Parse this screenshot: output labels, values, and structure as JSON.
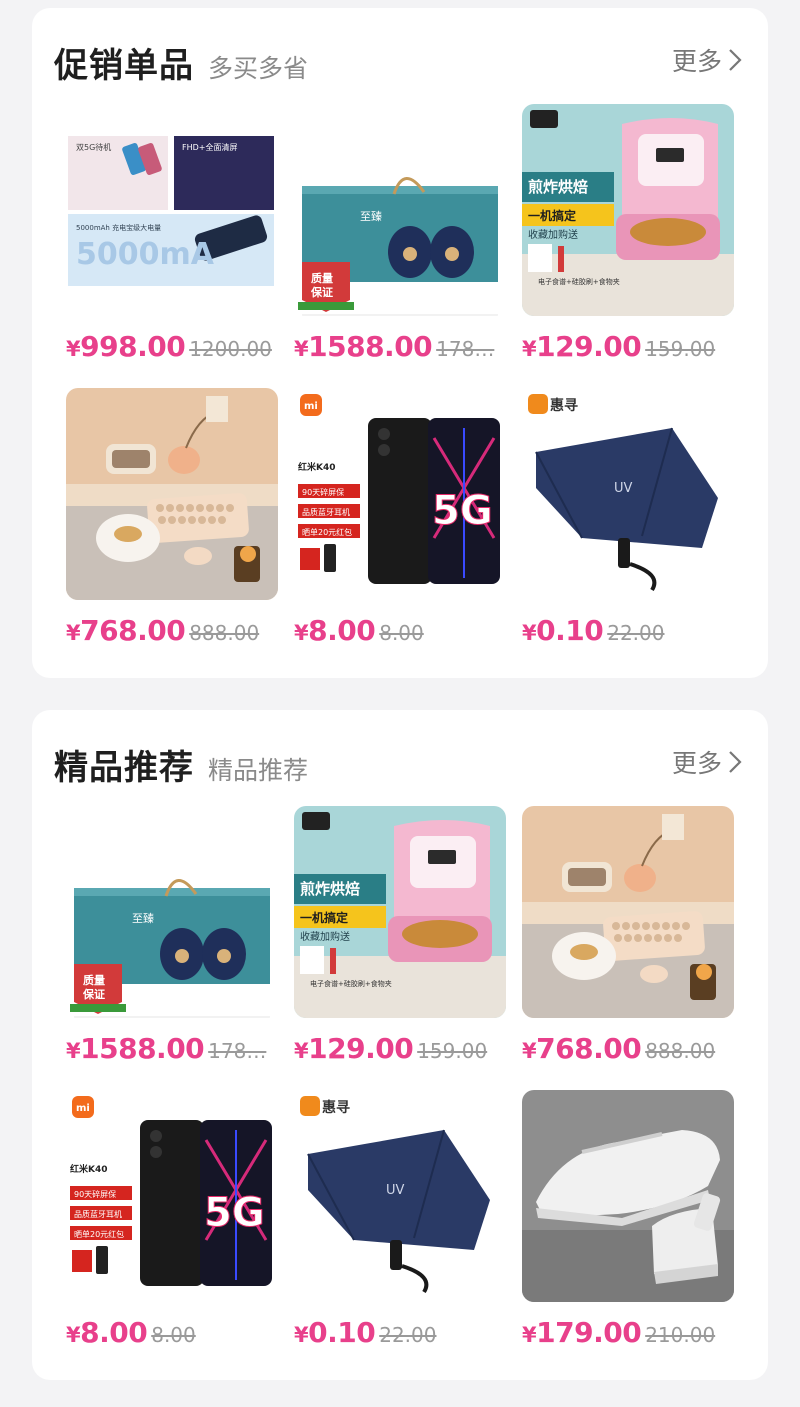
{
  "sections": [
    {
      "title": "促销单品",
      "subtitle": "多买多省",
      "more": "更多",
      "items": [
        {
          "product": "phone-collage",
          "currency": "¥",
          "price": "998.00",
          "orig": "1200.00",
          "caption_a": "双5G待机",
          "caption_b": "FHD+全面清屏",
          "caption_c": "5000mAh 充电宝级大电量",
          "caption_d": "5000mA"
        },
        {
          "product": "tea-gift-box",
          "currency": "¥",
          "price": "1588.00",
          "orig": "178…",
          "badge_a": "质量",
          "badge_b": "保证",
          "brand": "至臻"
        },
        {
          "product": "air-fryer",
          "currency": "¥",
          "price": "129.00",
          "orig": "159.00",
          "line1": "煎炸烘焙",
          "line2": "一机搞定",
          "line3": "收藏加购送",
          "note": "电子食谱+硅胶刷+食物夹"
        },
        {
          "product": "retro-keyboard",
          "currency": "¥",
          "price": "768.00",
          "orig": "888.00"
        },
        {
          "product": "redmi-k40",
          "currency": "¥",
          "price": "8.00",
          "orig": "8.00",
          "model": "红米K40",
          "tag1": "90天碎屏保",
          "tag2": "品质蓝牙耳机",
          "tag3": "晒单20元红包",
          "mi": "mi",
          "big": "5G"
        },
        {
          "product": "uv-umbrella",
          "currency": "¥",
          "price": "0.10",
          "orig": "22.00",
          "logo": "惠寻",
          "uv": "UV"
        }
      ]
    },
    {
      "title": "精品推荐",
      "subtitle": "精品推荐",
      "more": "更多",
      "items": [
        {
          "product": "tea-gift-box",
          "currency": "¥",
          "price": "1588.00",
          "orig": "178…",
          "badge_a": "质量",
          "badge_b": "保证",
          "brand": "至臻"
        },
        {
          "product": "air-fryer",
          "currency": "¥",
          "price": "129.00",
          "orig": "159.00",
          "line1": "煎炸烘焙",
          "line2": "一机搞定",
          "line3": "收藏加购送",
          "note": "电子食谱+硅胶刷+食物夹"
        },
        {
          "product": "retro-keyboard",
          "currency": "¥",
          "price": "768.00",
          "orig": "888.00"
        },
        {
          "product": "redmi-k40",
          "currency": "¥",
          "price": "8.00",
          "orig": "8.00",
          "model": "红米K40",
          "tag1": "90天碎屏保",
          "tag2": "品质蓝牙耳机",
          "tag3": "晒单20元红包",
          "mi": "mi",
          "big": "5G"
        },
        {
          "product": "uv-umbrella",
          "currency": "¥",
          "price": "0.10",
          "orig": "22.00",
          "logo": "惠寻",
          "uv": "UV"
        },
        {
          "product": "white-sneaker",
          "currency": "¥",
          "price": "179.00",
          "orig": "210.00"
        }
      ]
    }
  ],
  "colors": {
    "price": "#e8408b",
    "original_price": "#9a9a9a",
    "card": "#ffffff",
    "background": "#f3f3f5"
  }
}
